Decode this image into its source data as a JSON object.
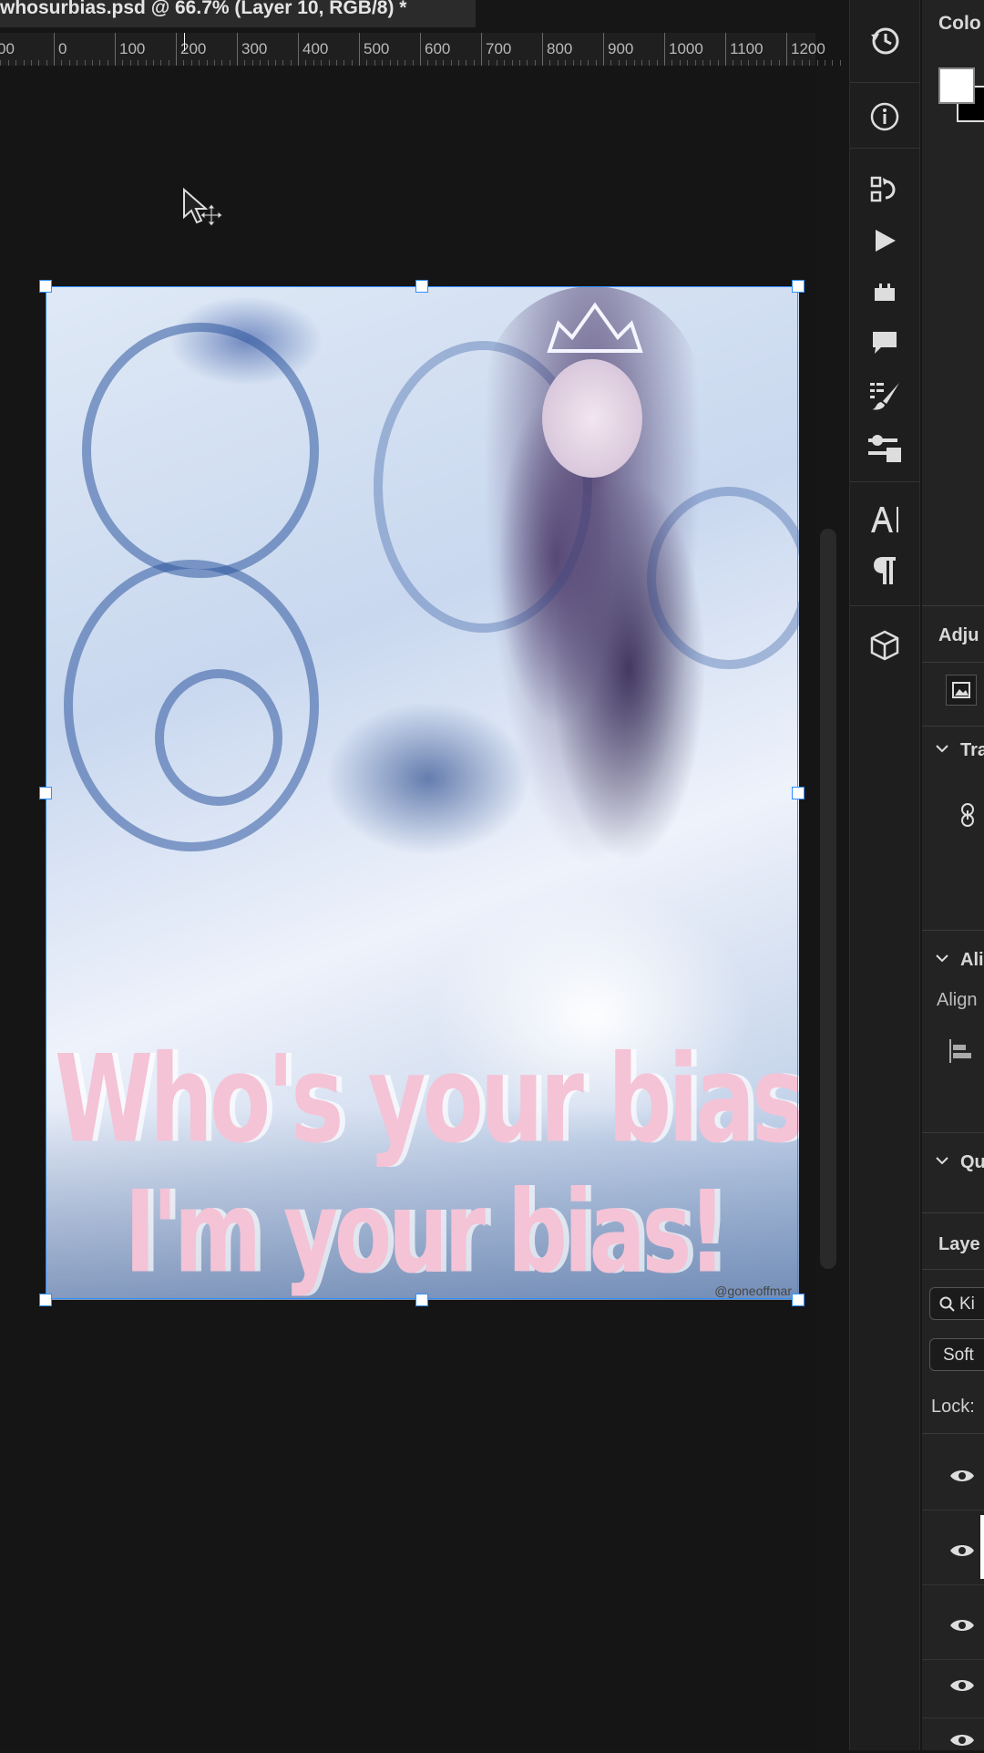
{
  "document": {
    "title": "whosurbias.psd @ 66.7% (Layer 10, RGB/8) *"
  },
  "ruler": {
    "labels": [
      "00",
      "0",
      "100",
      "200",
      "300",
      "400",
      "500",
      "600",
      "700",
      "800",
      "900",
      "1000",
      "1100",
      "1200"
    ]
  },
  "artwork": {
    "line1": "Who's your bias?",
    "line2": "I'm your bias!",
    "watermark": "@goneoffmar"
  },
  "tools": {
    "items": [
      "history-icon",
      "info-icon",
      "adjust-history-icon",
      "play-icon",
      "plugin-icon",
      "comment-icon",
      "brush-preset-icon",
      "tool-presets-icon",
      "character-icon",
      "paragraph-icon",
      "3d-icon"
    ]
  },
  "panel": {
    "color_title": "Colo",
    "adjustments_title": "Adju",
    "transform_title": "Tra",
    "align_title": "Ali",
    "align_label": "Align",
    "quick_title": "Qu",
    "layers_title": "Laye",
    "search_placeholder": "Ki",
    "blend_mode": "Soft",
    "lock_label": "Lock:"
  },
  "colors": {
    "accent": "#2f8fff",
    "foreground_swatch": "#ffffff",
    "background_swatch": "#000000"
  }
}
